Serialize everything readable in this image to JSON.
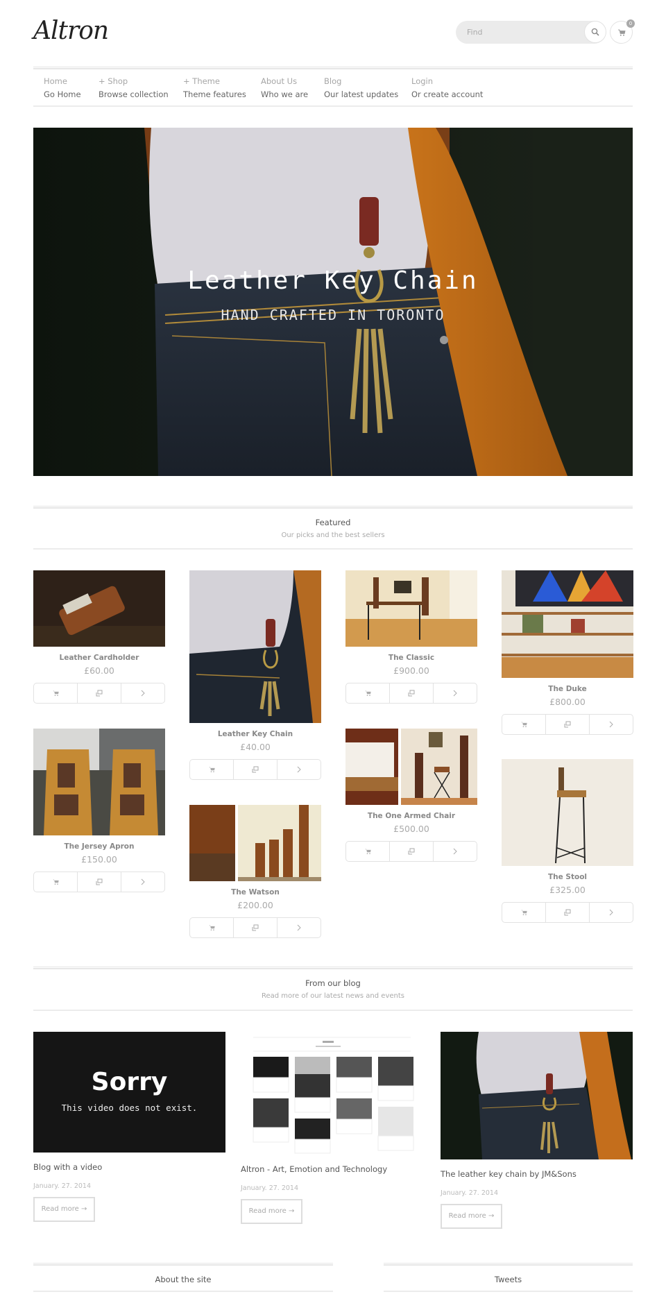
{
  "header": {
    "logo": "Altron",
    "search_placeholder": "Find",
    "cart_count": "0"
  },
  "nav": [
    {
      "label": "Home",
      "sub": "Go Home"
    },
    {
      "label": "+ Shop",
      "sub": "Browse collection"
    },
    {
      "label": "+ Theme",
      "sub": "Theme features"
    },
    {
      "label": "About Us",
      "sub": "Who we are"
    },
    {
      "label": "Blog",
      "sub": "Our latest updates"
    },
    {
      "label": "Login",
      "sub": "Or create account"
    }
  ],
  "hero": {
    "title": "Leather Key Chain",
    "subtitle": "HAND CRAFTED IN TORONTO"
  },
  "featured": {
    "title": "Featured",
    "subtitle": "Our picks and the best sellers",
    "products": [
      {
        "name": "Leather Cardholder",
        "price": "£60.00"
      },
      {
        "name": "Leather Key Chain",
        "price": "£40.00"
      },
      {
        "name": "The Classic",
        "price": "£900.00"
      },
      {
        "name": "The Duke",
        "price": "£800.00"
      },
      {
        "name": "The Jersey Apron",
        "price": "£150.00"
      },
      {
        "name": "The Watson",
        "price": "£200.00"
      },
      {
        "name": "The One Armed Chair",
        "price": "£500.00"
      },
      {
        "name": "The Stool",
        "price": "£325.00"
      }
    ]
  },
  "blog": {
    "title": "From our blog",
    "subtitle": "Read more of our latest news and events",
    "posts": [
      {
        "title": "Blog with a video",
        "date": "January. 27. 2014",
        "more": "Read more →",
        "video_error_title": "Sorry",
        "video_error_text": "This video does not exist."
      },
      {
        "title": "Altron - Art, Emotion and Technology",
        "date": "January. 27. 2014",
        "more": "Read more →"
      },
      {
        "title": "The leather key chain by JM&Sons",
        "date": "January. 27. 2014",
        "more": "Read more →"
      }
    ]
  },
  "footer": {
    "about_title": "About the site",
    "tweets_title": "Tweets"
  }
}
